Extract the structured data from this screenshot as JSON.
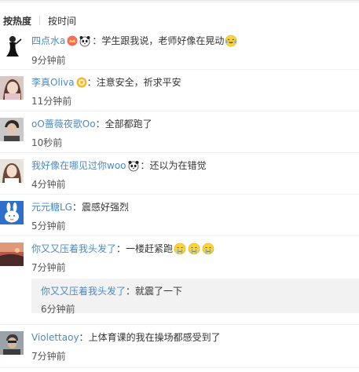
{
  "sort": {
    "hot": "按热度",
    "time": "按时间"
  },
  "colon": "：",
  "comments": [
    {
      "user": "四点水a",
      "text": "学生跟我说，老师好像在晃动",
      "time": "9分钟前"
    },
    {
      "user": "李真Oliva",
      "text": "注意安全，祈求平安",
      "time": "11分钟前"
    },
    {
      "user": "oO蔷薇夜歌Oo",
      "text": "全部都跑了",
      "time": "10秒前"
    },
    {
      "user": "我好像在哪见过你woo",
      "text": "还以为在错觉",
      "time": "4分钟前"
    },
    {
      "user": "元元糖LG",
      "text": "震感好强烈",
      "time": "5分钟前"
    },
    {
      "user": "你又又压着我头发了",
      "text": "一楼赶紧跑",
      "time": "7分钟前"
    },
    {
      "user": "Violettaoy",
      "text": "上体育课的我在操场都感受到了",
      "time": "7分钟前"
    }
  ],
  "reply": {
    "user": "你又又压着我头发了",
    "text": "就震了一下",
    "time": "6分钟前"
  },
  "colors": {
    "username_link": "#4a8bc2",
    "vip_username": "#eb7350",
    "text": "#333333",
    "reply_bg": "#f2f2f2"
  },
  "icons": [
    "vip-crown-badge",
    "panda-emoji",
    "laughing-tears-emoji",
    "member-badge",
    "crying-face-emoji"
  ]
}
